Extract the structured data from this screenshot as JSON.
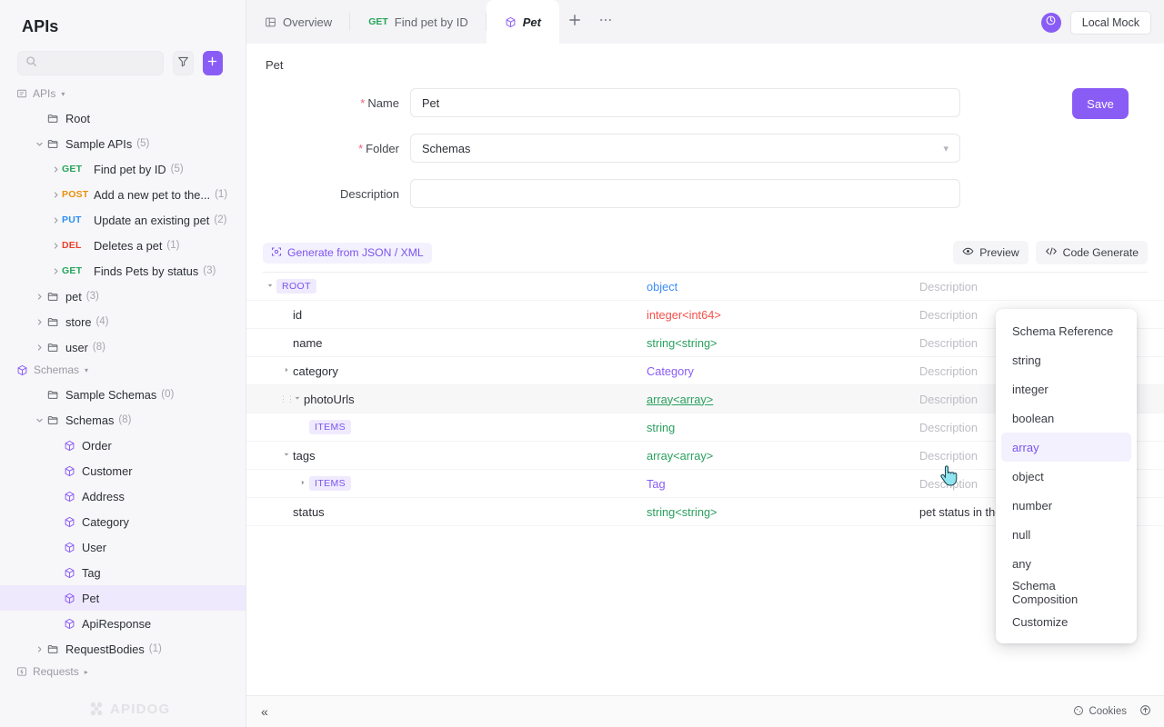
{
  "sidebar": {
    "title": "APIs",
    "search": {
      "placeholder": "",
      "value": ""
    },
    "filter_icon": "filter-icon",
    "add_icon": "plus-icon",
    "groups": [
      {
        "label": "APIs",
        "icon": "apis-icon",
        "nodes": [
          {
            "label": "Root",
            "icon": "folder-icon",
            "depth": 1,
            "twisty": "",
            "count": ""
          },
          {
            "label": "Sample APIs",
            "icon": "folder-icon",
            "depth": 1,
            "twisty": "down",
            "count": "(5)"
          },
          {
            "label": "Find pet by ID",
            "method": "GET",
            "depth": 2,
            "twisty": "right",
            "count": "(5)"
          },
          {
            "label": "Add a new pet to the...",
            "method": "POST",
            "depth": 2,
            "twisty": "right",
            "count": "(1)"
          },
          {
            "label": "Update an existing pet",
            "method": "PUT",
            "depth": 2,
            "twisty": "right",
            "count": "(2)"
          },
          {
            "label": "Deletes a pet",
            "method": "DEL",
            "depth": 2,
            "twisty": "right",
            "count": "(1)"
          },
          {
            "label": "Finds Pets by status",
            "method": "GET",
            "depth": 2,
            "twisty": "right",
            "count": "(3)"
          },
          {
            "label": "pet",
            "icon": "folder-icon",
            "depth": 1,
            "twisty": "right",
            "count": "(3)"
          },
          {
            "label": "store",
            "icon": "folder-icon",
            "depth": 1,
            "twisty": "right",
            "count": "(4)"
          },
          {
            "label": "user",
            "icon": "folder-icon",
            "depth": 1,
            "twisty": "right",
            "count": "(8)"
          }
        ]
      },
      {
        "label": "Schemas",
        "icon": "schema-icon",
        "nodes": [
          {
            "label": "Sample Schemas",
            "icon": "folder-icon",
            "depth": 1,
            "twisty": "",
            "count": "(0)"
          },
          {
            "label": "Schemas",
            "icon": "folder-icon",
            "depth": 1,
            "twisty": "down",
            "count": "(8)"
          },
          {
            "label": "Order",
            "icon": "schema-icon",
            "depth": 2,
            "twisty": "",
            "count": ""
          },
          {
            "label": "Customer",
            "icon": "schema-icon",
            "depth": 2,
            "twisty": "",
            "count": ""
          },
          {
            "label": "Address",
            "icon": "schema-icon",
            "depth": 2,
            "twisty": "",
            "count": ""
          },
          {
            "label": "Category",
            "icon": "schema-icon",
            "depth": 2,
            "twisty": "",
            "count": ""
          },
          {
            "label": "User",
            "icon": "schema-icon",
            "depth": 2,
            "twisty": "",
            "count": ""
          },
          {
            "label": "Tag",
            "icon": "schema-icon",
            "depth": 2,
            "twisty": "",
            "count": ""
          },
          {
            "label": "Pet",
            "icon": "schema-icon",
            "depth": 2,
            "twisty": "",
            "count": "",
            "selected": true
          },
          {
            "label": "ApiResponse",
            "icon": "schema-icon",
            "depth": 2,
            "twisty": "",
            "count": ""
          },
          {
            "label": "RequestBodies",
            "icon": "folder-icon",
            "depth": 1,
            "twisty": "right",
            "count": "(1)"
          }
        ]
      },
      {
        "label": "Requests",
        "icon": "requests-icon",
        "nodes": []
      }
    ],
    "watermark": "APIDOG"
  },
  "tabs": [
    {
      "label": "Overview",
      "icon": "overview-icon",
      "active": false
    },
    {
      "label": "Find pet by ID",
      "method": "GET",
      "active": false
    },
    {
      "label": "Pet",
      "icon": "schema-icon",
      "active": true
    }
  ],
  "tabbar": {
    "new_tab_icon": "plus-icon",
    "more_icon": "ellipsis-icon",
    "mock_badge_icon": "mock-icon",
    "mock_label": "Local Mock"
  },
  "page": {
    "breadcrumb": "Pet",
    "save_label": "Save",
    "fields": [
      {
        "label": "Name",
        "required": true,
        "value": "Pet",
        "type": "text"
      },
      {
        "label": "Folder",
        "required": true,
        "value": "Schemas",
        "type": "select"
      },
      {
        "label": "Description",
        "required": false,
        "value": "",
        "type": "text"
      }
    ]
  },
  "schema_toolbar": {
    "generate_label": "Generate from JSON / XML",
    "generate_icon": "generate-icon",
    "preview_label": "Preview",
    "preview_icon": "eye-icon",
    "code_label": "Code Generate",
    "code_icon": "code-icon"
  },
  "schema_rows": [
    {
      "name": "ROOT",
      "isBadge": true,
      "depth": 0,
      "twisty": "down",
      "type": "object",
      "typeClass": "t-object",
      "desc": "Description"
    },
    {
      "name": "id",
      "depth": 1,
      "twisty": "",
      "type": "integer<int64>",
      "typeClass": "t-int",
      "desc": "Description"
    },
    {
      "name": "name",
      "depth": 1,
      "twisty": "",
      "type": "string<string>",
      "typeClass": "t-string",
      "desc": "Description"
    },
    {
      "name": "category",
      "depth": 1,
      "twisty": "right",
      "type": "Category",
      "typeClass": "t-ref",
      "desc": "Description"
    },
    {
      "name": "photoUrls",
      "depth": 1,
      "twisty": "down",
      "type": "array<array>",
      "typeClass": "t-array act",
      "desc": "Description",
      "highlight": true,
      "drag": true
    },
    {
      "name": "ITEMS",
      "isBadge": true,
      "depth": 2,
      "twisty": "",
      "type": "string",
      "typeClass": "t-string",
      "desc": "Description"
    },
    {
      "name": "tags",
      "depth": 1,
      "twisty": "down",
      "type": "array<array>",
      "typeClass": "t-array",
      "desc": "Description"
    },
    {
      "name": "ITEMS",
      "isBadge": true,
      "depth": 2,
      "twisty": "right",
      "type": "Tag",
      "typeClass": "t-ref",
      "desc": "Description"
    },
    {
      "name": "status",
      "depth": 1,
      "twisty": "",
      "type": "string<string>",
      "typeClass": "t-string",
      "desc": "pet status in the store",
      "descFilled": true
    }
  ],
  "type_menu": {
    "items": [
      {
        "label": "Schema Reference",
        "active": false
      },
      {
        "label": "string",
        "active": false
      },
      {
        "label": "integer",
        "active": false
      },
      {
        "label": "boolean",
        "active": false
      },
      {
        "label": "array",
        "active": true
      },
      {
        "label": "object",
        "active": false
      },
      {
        "label": "number",
        "active": false
      },
      {
        "label": "null",
        "active": false
      },
      {
        "label": "any",
        "active": false
      },
      {
        "label": "Schema Composition",
        "active": false
      },
      {
        "label": "Customize",
        "active": false
      }
    ]
  },
  "bottombar": {
    "collapse_icon": "collapse-icon",
    "cookies_label": "Cookies",
    "cookies_icon": "cookie-icon",
    "upload_icon": "upload-icon"
  },
  "colors": {
    "accent": "#8a5cf6",
    "get": "#25a55a",
    "post": "#e8900a",
    "put": "#2b8ef0",
    "del": "#e8402a",
    "required": "#f0607a"
  }
}
